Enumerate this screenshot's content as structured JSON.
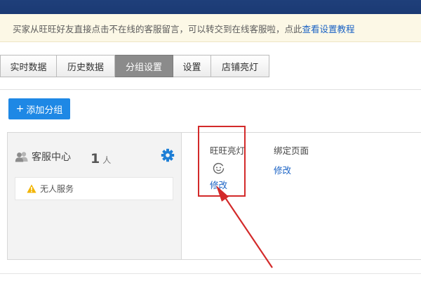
{
  "notice": {
    "text": "买家从旺旺好友直接点击不在线的客服留言，可以转交到在线客服啦，点此",
    "link": "查看设置教程"
  },
  "tabs": [
    {
      "label": "实时数据",
      "active": false
    },
    {
      "label": "历史数据",
      "active": false
    },
    {
      "label": "分组设置",
      "active": true
    },
    {
      "label": "设置",
      "active": false
    },
    {
      "label": "店铺亮灯",
      "active": false
    }
  ],
  "add_group_button": {
    "label": "添加分组",
    "icon": "plus-icon"
  },
  "group": {
    "name": "客服中心",
    "count": "1",
    "count_unit": "人",
    "status": "无人服务",
    "icons": {
      "user": "user-group-icon",
      "settings": "gear-icon",
      "warning": "warning-icon"
    }
  },
  "columns": {
    "wangwang_light": {
      "header": "旺旺亮灯",
      "icon": "smiley-face-icon",
      "action": "修改"
    },
    "bind_page": {
      "header": "绑定页面",
      "action": "修改"
    }
  },
  "colors": {
    "accent": "#1e88e5",
    "link": "#1a62c4",
    "highlight": "#d32a2a",
    "gear": "#1e7fd6",
    "warning": "#f2b400"
  }
}
